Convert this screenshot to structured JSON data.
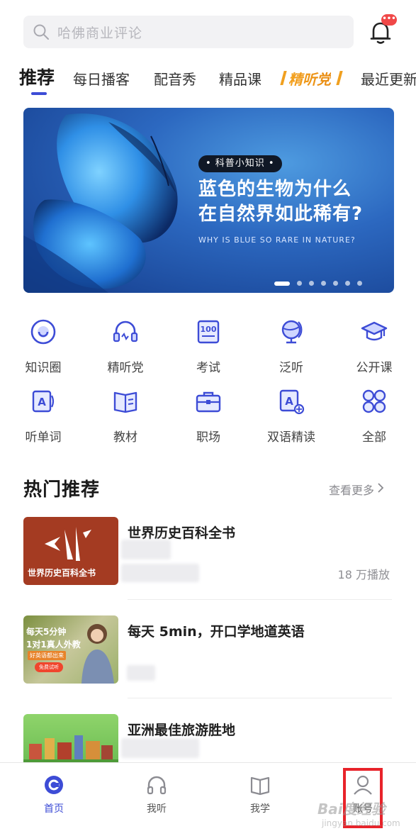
{
  "search": {
    "placeholder": "哈佛商业评论"
  },
  "notification": {
    "badge": "•••"
  },
  "tabs": [
    {
      "label": "推荐"
    },
    {
      "label": "每日播客"
    },
    {
      "label": "配音秀"
    },
    {
      "label": "精品课"
    },
    {
      "label": "精听党"
    },
    {
      "label": "最近更新"
    }
  ],
  "banner": {
    "tag": "• 科普小知识 •",
    "headline_line1": "蓝色的生物为什么",
    "headline_line2": "在自然界如此稀有?",
    "subtitle": "WHY IS BLUE SO RARE IN NATURE?",
    "slide_count": 7,
    "active_slide": 1
  },
  "grid": [
    {
      "label": "知识圈",
      "icon": "knowledge-circle-icon"
    },
    {
      "label": "精听党",
      "icon": "headset-icon"
    },
    {
      "label": "考试",
      "icon": "exam-100-icon"
    },
    {
      "label": "泛听",
      "icon": "globe-icon"
    },
    {
      "label": "公开课",
      "icon": "graduation-cap-icon"
    },
    {
      "label": "听单词",
      "icon": "word-card-icon"
    },
    {
      "label": "教材",
      "icon": "textbook-icon"
    },
    {
      "label": "职场",
      "icon": "briefcase-icon"
    },
    {
      "label": "双语精读",
      "icon": "bilingual-read-icon"
    },
    {
      "label": "全部",
      "icon": "all-apps-icon"
    }
  ],
  "hot": {
    "title": "热门推荐",
    "more": "查看更多"
  },
  "items": [
    {
      "title": "世界历史百科全书",
      "plays": "18 万播放",
      "thumb_text": "世界历史百科全书"
    },
    {
      "title": "每天 5min，开口学地道英语",
      "plays": "",
      "thumb_line1": "每天5分钟",
      "thumb_line2": "1对1真人外教",
      "thumb_line3": "好英语都出来",
      "thumb_btn": "免费试听"
    },
    {
      "title": "亚洲最佳旅游胜地",
      "plays": ""
    }
  ],
  "nav": [
    {
      "label": "首页",
      "icon": "home-icon",
      "active": true
    },
    {
      "label": "我听",
      "icon": "headphones-icon",
      "active": false
    },
    {
      "label": "我学",
      "icon": "book-open-icon",
      "active": false
    },
    {
      "label": "账号",
      "icon": "user-icon",
      "active": false
    }
  ],
  "watermark": {
    "text": "Bai度经验",
    "url": "jingyan.baidu.com"
  },
  "colors": {
    "accent": "#3d4cd6",
    "badge": "#f04848",
    "vip": "#f0a020",
    "highlight": "#e8232a"
  }
}
